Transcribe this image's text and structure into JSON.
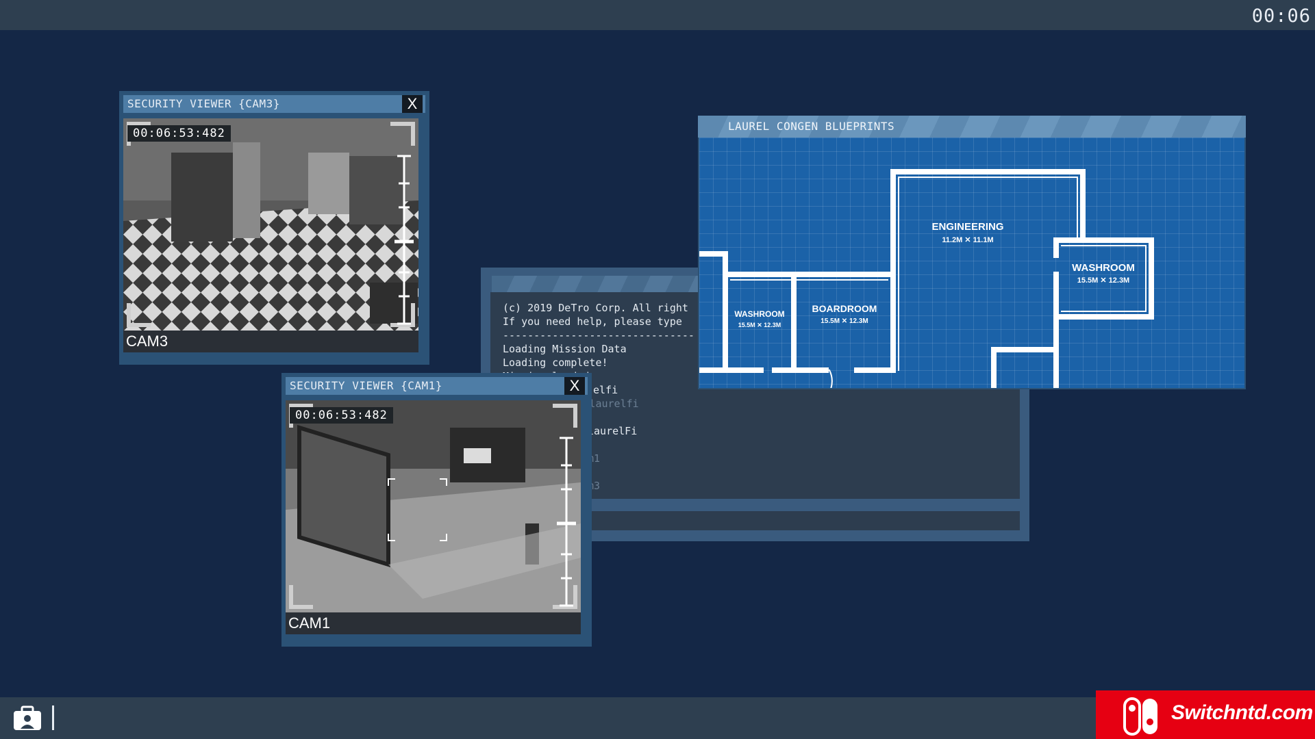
{
  "clock": "00:06",
  "cam3": {
    "title": "SECURITY VIEWER {CAM3}",
    "close": "X",
    "timestamp": "00:06:53:482",
    "label": "CAM3"
  },
  "cam1": {
    "title": "SECURITY VIEWER {CAM1}",
    "close": "X",
    "timestamp": "00:06:53:482",
    "label": "CAM1"
  },
  "terminal": {
    "lines": [
      "(c) 2019 DeTro Corp. All right",
      "If you need help, please type",
      "-------------------------------",
      "Loading Mission Data",
      "Loading complete!",
      "Mission loaded",
      "elfi",
      "Connecting to laurelfi",
      "laurelFi",
      "m1",
      "m3"
    ]
  },
  "blueprint": {
    "title": "LAUREL CONGEN BLUEPRINTS",
    "rooms": [
      {
        "name": "ENGINEERING",
        "size": "11.2M  ✕  11.1M"
      },
      {
        "name": "WASHROOM",
        "size": "15.5M  ✕  12.3M"
      },
      {
        "name": "BOARDROOM",
        "size": "15.5M  ✕  12.3M"
      },
      {
        "name": "WASHROOM",
        "size": "15.5M  ✕  12.3M"
      }
    ]
  },
  "brand": {
    "text": "Switchntd.com"
  },
  "colors": {
    "background": "#142746",
    "bars": "#2e3f50",
    "window": "#2b5276",
    "blueprint": "#1b62a8",
    "brand": "#e60012"
  },
  "icons": {
    "taskbar": "briefcase-user-icon"
  }
}
